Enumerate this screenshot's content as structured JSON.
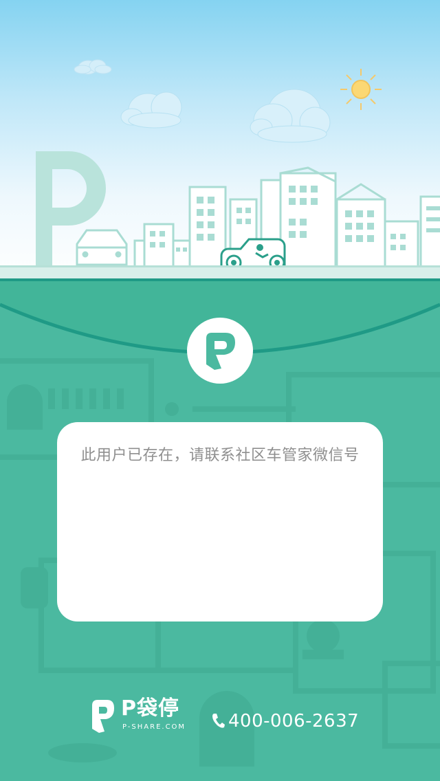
{
  "app": {
    "brand_name": "P袋停",
    "brand_domain": "P-SHARE.COM",
    "phone": "400-006-2637"
  },
  "message": {
    "text": "此用户已存在，请联系社区车管家微信号"
  },
  "icons": {
    "logo": "p-share-logo-icon",
    "phone": "phone-icon",
    "sun": "sun-icon",
    "parking_sign": "parking-sign-icon",
    "car": "car-icon"
  },
  "colors": {
    "primary": "#4bb9a0",
    "arc": "#1f9a86",
    "sky_top": "#85d3f1",
    "city": "#a9dcd3",
    "card": "#ffffff",
    "message_text": "#8f8f8f"
  }
}
